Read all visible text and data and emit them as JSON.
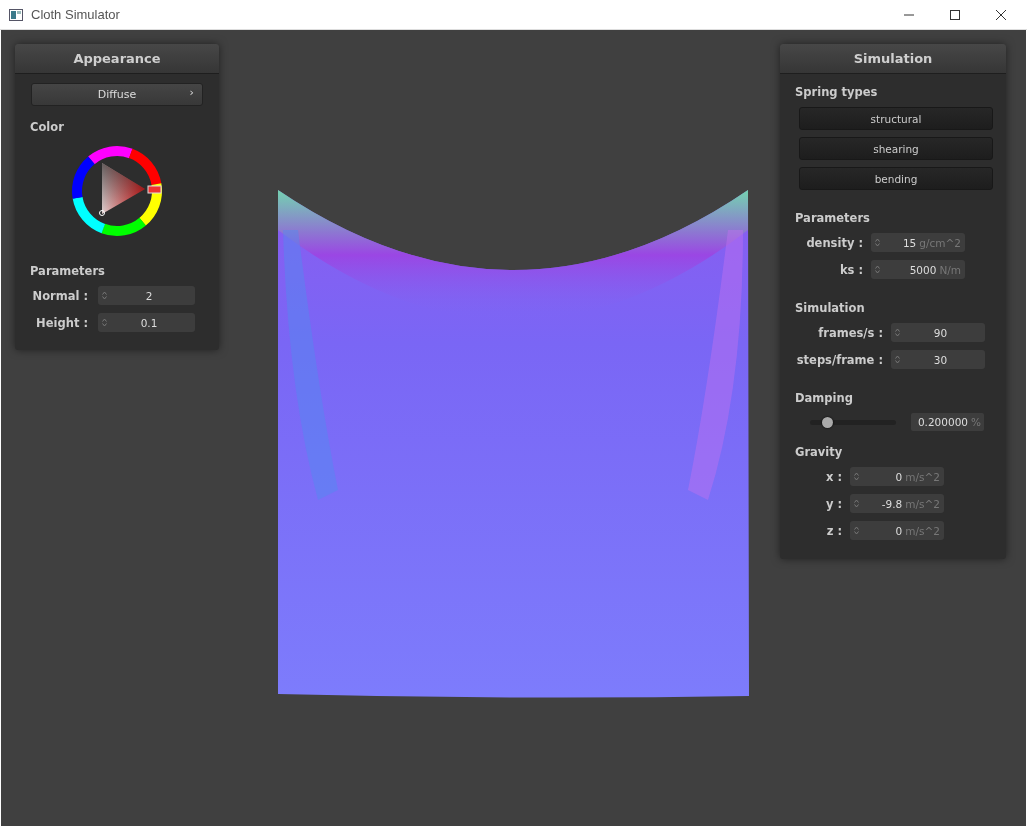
{
  "window": {
    "title": "Cloth Simulator"
  },
  "appearance": {
    "title": "Appearance",
    "shader": "Diffuse",
    "shader_caret": "›",
    "color_label": "Color",
    "parameters_label": "Parameters",
    "fields": [
      {
        "label": "Normal :",
        "value": "2"
      },
      {
        "label": "Height :",
        "value": "0.1"
      }
    ]
  },
  "simulation_panel": {
    "title": "Simulation",
    "spring_types_label": "Spring types",
    "spring_types": [
      {
        "label": "structural"
      },
      {
        "label": "shearing"
      },
      {
        "label": "bending"
      }
    ],
    "parameters_label": "Parameters",
    "parameters": [
      {
        "label": "density :",
        "value": "15",
        "unit": "g/cm^2"
      },
      {
        "label": "ks :",
        "value": "5000",
        "unit": "N/m"
      }
    ],
    "simulation_label": "Simulation",
    "simulation": [
      {
        "label": "frames/s :",
        "value": "90"
      },
      {
        "label": "steps/frame :",
        "value": "30"
      }
    ],
    "damping_label": "Damping",
    "damping": {
      "level": 0.2,
      "value": "0.200000",
      "unit": "%"
    },
    "gravity_label": "Gravity",
    "gravity": [
      {
        "label": "x :",
        "value": "0",
        "unit": "m/s^2"
      },
      {
        "label": "y :",
        "value": "-9.8",
        "unit": "m/s^2"
      },
      {
        "label": "z :",
        "value": "0",
        "unit": "m/s^2"
      }
    ]
  }
}
